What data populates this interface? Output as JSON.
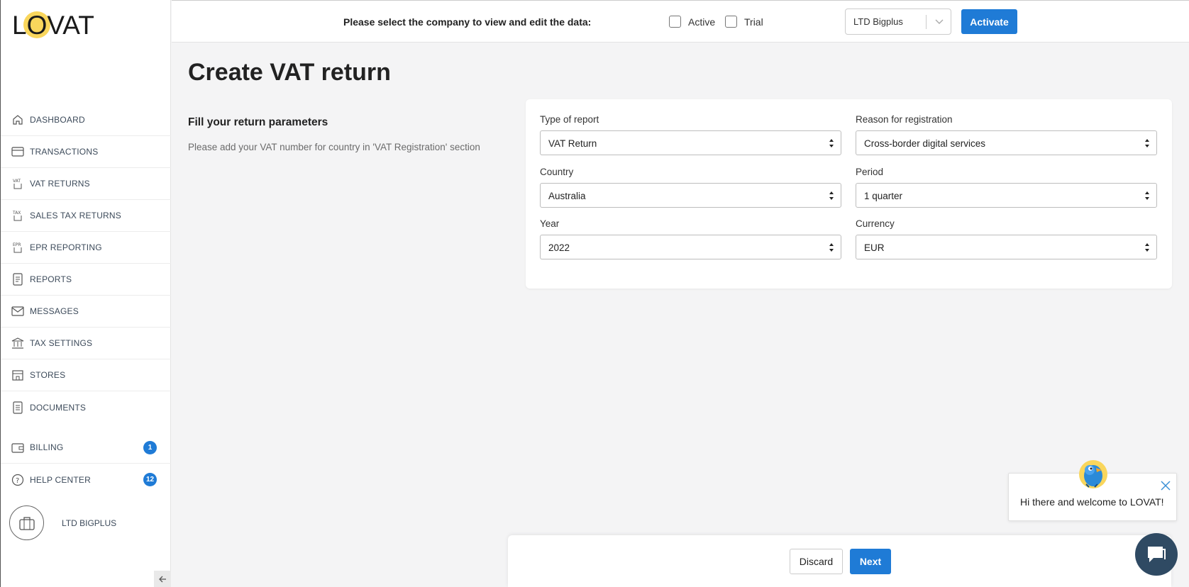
{
  "brand": {
    "logo_text": "LOVAT",
    "accent": "#1f7bd6",
    "sun_color": "#f9d65c"
  },
  "sidebar": {
    "items": [
      {
        "label": "DASHBOARD",
        "icon": "home-icon"
      },
      {
        "label": "TRANSACTIONS",
        "icon": "card-icon"
      },
      {
        "label": "VAT RETURNS",
        "icon": "vat-doc-icon"
      },
      {
        "label": "SALES TAX RETURNS",
        "icon": "tax-doc-icon"
      },
      {
        "label": "EPR REPORTING",
        "icon": "epr-doc-icon"
      },
      {
        "label": "REPORTS",
        "icon": "report-icon"
      },
      {
        "label": "MESSAGES",
        "icon": "envelope-icon"
      },
      {
        "label": "TAX SETTINGS",
        "icon": "bank-icon"
      },
      {
        "label": "STORES",
        "icon": "store-icon"
      },
      {
        "label": "DOCUMENTS",
        "icon": "document-icon"
      }
    ],
    "billing": {
      "label": "BILLING",
      "badge": "1"
    },
    "help": {
      "label": "HELP CENTER",
      "badge": "12"
    },
    "company_name": "LTD BIGPLUS"
  },
  "topbar": {
    "prompt": "Please select the company to view and edit the data:",
    "active_label": "Active",
    "trial_label": "Trial",
    "company_select": "LTD Bigplus",
    "activate_label": "Activate"
  },
  "main": {
    "title": "Create VAT return",
    "section_title": "Fill your return parameters",
    "section_desc": "Please add your VAT number for country in 'VAT Registration' section"
  },
  "form": {
    "type_label": "Type of report",
    "type_value": "VAT Return",
    "reason_label": "Reason for registration",
    "reason_value": "Cross-border digital services",
    "country_label": "Country",
    "country_value": "Australia",
    "period_label": "Period",
    "period_value": "1 quarter",
    "year_label": "Year",
    "year_value": "2022",
    "currency_label": "Currency",
    "currency_value": "EUR"
  },
  "actions": {
    "discard_label": "Discard",
    "next_label": "Next"
  },
  "chat": {
    "message": "Hi there and welcome to LOVAT!"
  }
}
